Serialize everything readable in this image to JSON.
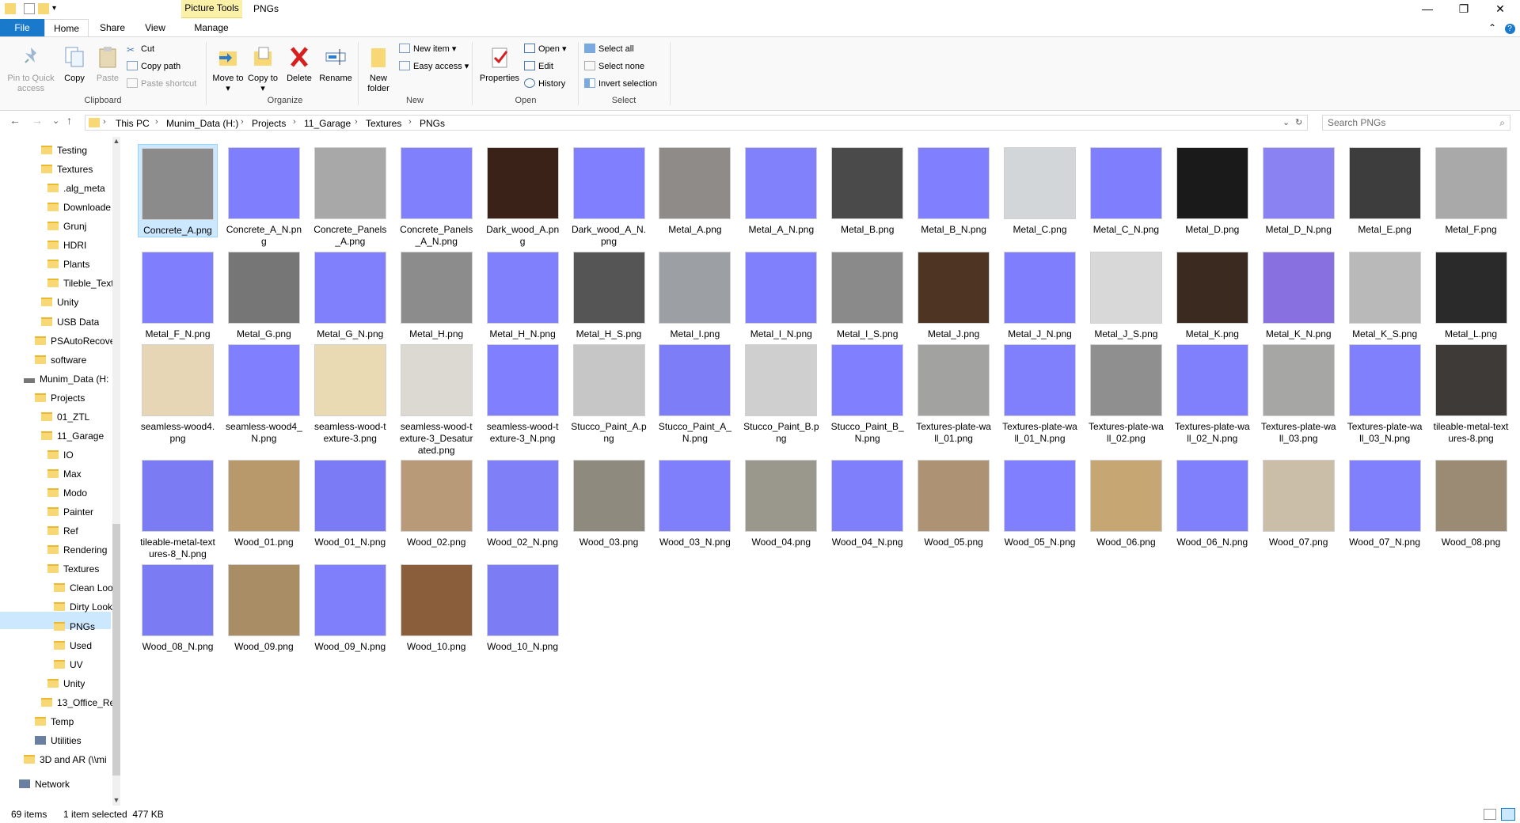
{
  "window": {
    "title": "PNGs",
    "context_tab": "Picture Tools",
    "minimize": "—",
    "maximize": "❐",
    "close": "✕"
  },
  "tabs": {
    "file": "File",
    "home": "Home",
    "share": "Share",
    "view": "View",
    "manage": "Manage"
  },
  "ribbon": {
    "clipboard": {
      "pin": "Pin to Quick access",
      "copy": "Copy",
      "paste": "Paste",
      "cut": "Cut",
      "copy_path": "Copy path",
      "paste_shortcut": "Paste shortcut",
      "group": "Clipboard"
    },
    "organize": {
      "move_to": "Move to",
      "copy_to": "Copy to",
      "delete": "Delete",
      "rename": "Rename",
      "group": "Organize"
    },
    "new": {
      "new_folder": "New folder",
      "new_item": "New item",
      "easy_access": "Easy access",
      "group": "New"
    },
    "open": {
      "properties": "Properties",
      "open": "Open",
      "edit": "Edit",
      "history": "History",
      "group": "Open"
    },
    "select": {
      "select_all": "Select all",
      "select_none": "Select none",
      "invert": "Invert selection",
      "group": "Select"
    }
  },
  "address": {
    "crumbs": [
      "This PC",
      "Munim_Data (H:)",
      "Projects",
      "11_Garage",
      "Textures",
      "PNGs"
    ],
    "search_placeholder": "Search PNGs"
  },
  "nav": [
    {
      "label": "Testing"
    },
    {
      "label": "Textures"
    },
    {
      "label": ".alg_meta"
    },
    {
      "label": "Downloade"
    },
    {
      "label": "Grunj"
    },
    {
      "label": "HDRI"
    },
    {
      "label": "Plants"
    },
    {
      "label": "Tileble_Text"
    },
    {
      "label": "Unity"
    },
    {
      "label": "USB Data"
    },
    {
      "label": "PSAutoRecove"
    },
    {
      "label": "software"
    },
    {
      "label": "Munim_Data (H:"
    },
    {
      "label": "Projects"
    },
    {
      "label": "01_ZTL"
    },
    {
      "label": "11_Garage"
    },
    {
      "label": "IO"
    },
    {
      "label": "Max"
    },
    {
      "label": "Modo"
    },
    {
      "label": "Painter"
    },
    {
      "label": "Ref"
    },
    {
      "label": "Rendering"
    },
    {
      "label": "Textures"
    },
    {
      "label": "Clean Loo"
    },
    {
      "label": "Dirty Look"
    },
    {
      "label": "PNGs"
    },
    {
      "label": "Used"
    },
    {
      "label": "UV"
    },
    {
      "label": "Unity"
    },
    {
      "label": "13_Office_Re"
    },
    {
      "label": "Temp"
    },
    {
      "label": "Utilities"
    },
    {
      "label": "3D and AR (\\\\mi"
    },
    {
      "label": "Network"
    }
  ],
  "files": [
    {
      "name": "Concrete_A.png",
      "color": "#8b8b8b"
    },
    {
      "name": "Concrete_A_N.png",
      "color": "#7f7ffe"
    },
    {
      "name": "Concrete_Panels_A.png",
      "color": "#a8a8a8"
    },
    {
      "name": "Concrete_Panels_A_N.png",
      "color": "#8080fd"
    },
    {
      "name": "Dark_wood_A.png",
      "color": "#3a2218"
    },
    {
      "name": "Dark_wood_A_N.png",
      "color": "#8080fe"
    },
    {
      "name": "Metal_A.png",
      "color": "#8e8b88"
    },
    {
      "name": "Metal_A_N.png",
      "color": "#8181fc"
    },
    {
      "name": "Metal_B.png",
      "color": "#4a4a4a"
    },
    {
      "name": "Metal_B_N.png",
      "color": "#8080fe"
    },
    {
      "name": "Metal_C.png",
      "color": "#d2d6d8"
    },
    {
      "name": "Metal_C_N.png",
      "color": "#7f7ffd"
    },
    {
      "name": "Metal_D.png",
      "color": "#1a1a1a"
    },
    {
      "name": "Metal_D_N.png",
      "color": "#8a82f2"
    },
    {
      "name": "Metal_E.png",
      "color": "#3d3d3d"
    },
    {
      "name": "Metal_F.png",
      "color": "#a9a9a9"
    },
    {
      "name": "Metal_F_N.png",
      "color": "#7f7ffe"
    },
    {
      "name": "Metal_G.png",
      "color": "#767676"
    },
    {
      "name": "Metal_G_N.png",
      "color": "#8080fc"
    },
    {
      "name": "Metal_H.png",
      "color": "#8c8c8c"
    },
    {
      "name": "Metal_H_N.png",
      "color": "#8080fd"
    },
    {
      "name": "Metal_H_S.png",
      "color": "#555555"
    },
    {
      "name": "Metal_I.png",
      "color": "#9c9fa3"
    },
    {
      "name": "Metal_I_N.png",
      "color": "#8080fd"
    },
    {
      "name": "Metal_I_S.png",
      "color": "#8a8a8a"
    },
    {
      "name": "Metal_J.png",
      "color": "#4e3423"
    },
    {
      "name": "Metal_J_N.png",
      "color": "#7f7ffe"
    },
    {
      "name": "Metal_J_S.png",
      "color": "#d8d8d8"
    },
    {
      "name": "Metal_K.png",
      "color": "#3a2a20"
    },
    {
      "name": "Metal_K_N.png",
      "color": "#8870e0"
    },
    {
      "name": "Metal_K_S.png",
      "color": "#b9b9b9"
    },
    {
      "name": "Metal_L.png",
      "color": "#2a2a2a"
    },
    {
      "name": "seamless-wood4.png",
      "color": "#e6d6b6"
    },
    {
      "name": "seamless-wood4_N.png",
      "color": "#8080fe"
    },
    {
      "name": "seamless-wood-texture-3.png",
      "color": "#eadab4"
    },
    {
      "name": "seamless-wood-texture-3_Desaturated.png",
      "color": "#dcd8d2"
    },
    {
      "name": "seamless-wood-texture-3_N.png",
      "color": "#8080fe"
    },
    {
      "name": "Stucco_Paint_A.png",
      "color": "#c6c6c6"
    },
    {
      "name": "Stucco_Paint_A_N.png",
      "color": "#7d7df8"
    },
    {
      "name": "Stucco_Paint_B.png",
      "color": "#cfcfcf"
    },
    {
      "name": "Stucco_Paint_B_N.png",
      "color": "#8080fe"
    },
    {
      "name": "Textures-plate-wall_01.png",
      "color": "#a2a2a0"
    },
    {
      "name": "Textures-plate-wall_01_N.png",
      "color": "#8080fd"
    },
    {
      "name": "Textures-plate-wall_02.png",
      "color": "#8f8f8f"
    },
    {
      "name": "Textures-plate-wall_02_N.png",
      "color": "#8080fc"
    },
    {
      "name": "Textures-plate-wall_03.png",
      "color": "#a6a6a4"
    },
    {
      "name": "Textures-plate-wall_03_N.png",
      "color": "#8080fd"
    },
    {
      "name": "tileable-metal-textures-8.png",
      "color": "#3e3a38"
    },
    {
      "name": "tileable-metal-textures-8_N.png",
      "color": "#7b7bf3"
    },
    {
      "name": "Wood_01.png",
      "color": "#b8996b"
    },
    {
      "name": "Wood_01_N.png",
      "color": "#7b7bf6"
    },
    {
      "name": "Wood_02.png",
      "color": "#b99a78"
    },
    {
      "name": "Wood_02_N.png",
      "color": "#7f80f8"
    },
    {
      "name": "Wood_03.png",
      "color": "#8e8a7e"
    },
    {
      "name": "Wood_03_N.png",
      "color": "#7f7ffb"
    },
    {
      "name": "Wood_04.png",
      "color": "#9a978c"
    },
    {
      "name": "Wood_04_N.png",
      "color": "#7f7ffb"
    },
    {
      "name": "Wood_05.png",
      "color": "#ad9373"
    },
    {
      "name": "Wood_05_N.png",
      "color": "#8080fe"
    },
    {
      "name": "Wood_06.png",
      "color": "#c6a774"
    },
    {
      "name": "Wood_06_N.png",
      "color": "#8080fd"
    },
    {
      "name": "Wood_07.png",
      "color": "#cabea8"
    },
    {
      "name": "Wood_07_N.png",
      "color": "#8080fd"
    },
    {
      "name": "Wood_08.png",
      "color": "#9c8b74"
    },
    {
      "name": "Wood_08_N.png",
      "color": "#7b7bf4"
    },
    {
      "name": "Wood_09.png",
      "color": "#a98d64"
    },
    {
      "name": "Wood_09_N.png",
      "color": "#7f7ffb"
    },
    {
      "name": "Wood_10.png",
      "color": "#8a5e3a"
    },
    {
      "name": "Wood_10_N.png",
      "color": "#7c7cf5"
    }
  ],
  "status": {
    "count": "69 items",
    "selection": "1 item selected  477 KB"
  },
  "colors": {
    "accent": "#1979ca",
    "selection": "#cce8ff",
    "picture_tools": "#fbf0a8"
  }
}
